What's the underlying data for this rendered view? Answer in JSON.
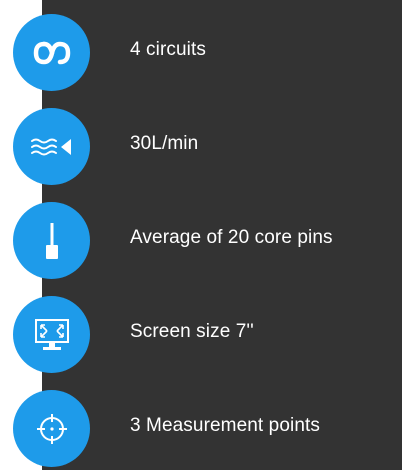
{
  "accent_color": "#1e9bea",
  "panel_color": "#333333",
  "features": [
    {
      "icon": "circuit-loop-icon",
      "label": "4 circuits"
    },
    {
      "icon": "flow-rate-icon",
      "label": "30L/min"
    },
    {
      "icon": "core-pin-icon",
      "label": "Average of 20 core pins"
    },
    {
      "icon": "monitor-screen-icon",
      "label": "Screen size 7''"
    },
    {
      "icon": "crosshair-target-icon",
      "label": "3 Measurement points"
    }
  ]
}
